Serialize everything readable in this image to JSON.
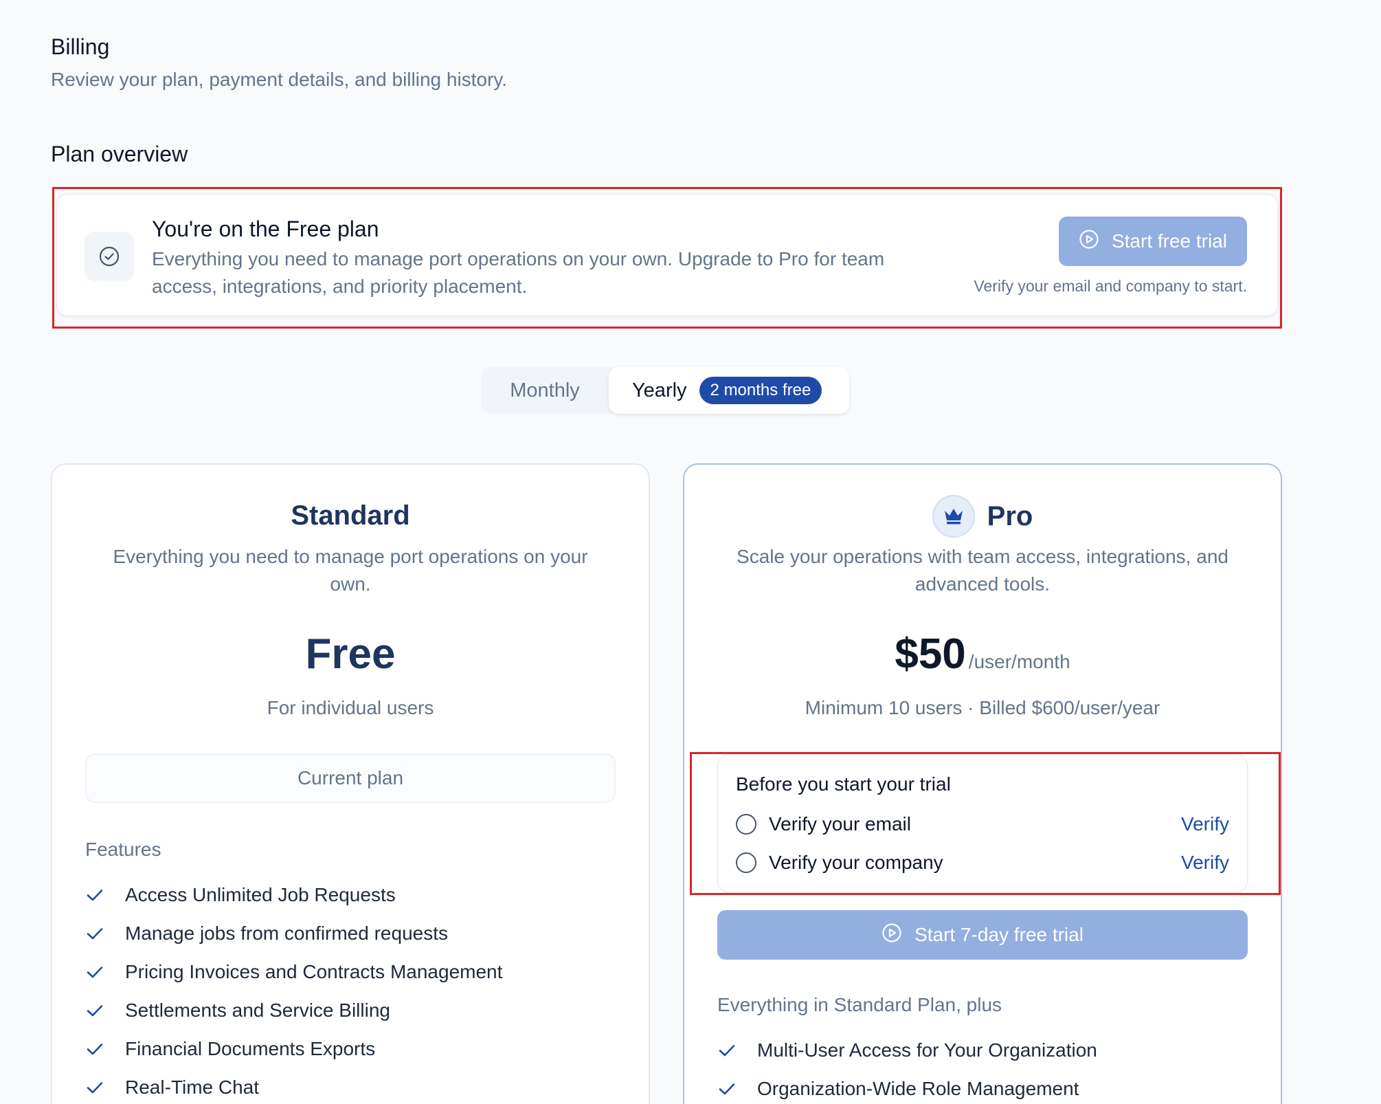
{
  "header": {
    "title": "Billing",
    "subtitle": "Review your plan, payment details, and billing history."
  },
  "plan_overview": {
    "section_title": "Plan overview",
    "banner": {
      "icon": "check-circle-icon",
      "title": "You're on the Free plan",
      "description": "Everything you need to manage port operations on your own. Upgrade to Pro for team access, integrations, and priority placement.",
      "button_icon": "play-circle-icon",
      "button_label": "Start free trial",
      "note": "Verify your email and company to start."
    }
  },
  "billing_toggle": {
    "options": [
      {
        "label": "Monthly",
        "selected": false
      },
      {
        "label": "Yearly",
        "selected": true,
        "badge": "2 months free"
      }
    ]
  },
  "plans": {
    "standard": {
      "name": "Standard",
      "description": "Everything you need to manage port operations on your own.",
      "price": "Free",
      "price_subtext": "For individual users",
      "button_label": "Current plan",
      "features_title": "Features",
      "features": [
        "Access Unlimited Job Requests",
        "Manage jobs from confirmed requests",
        "Pricing Invoices and Contracts Management",
        "Settlements and Service Billing",
        "Financial Documents Exports",
        "Real-Time Chat"
      ]
    },
    "pro": {
      "icon": "crown-icon",
      "name": "Pro",
      "description": "Scale your operations with team access, integrations, and advanced tools.",
      "price_amount": "$50",
      "price_unit": "/user/month",
      "price_subtext": "Minimum 10 users · Billed $600/user/year",
      "trial_checklist": {
        "title": "Before you start your trial",
        "steps": [
          {
            "label": "Verify your email",
            "action": "Verify",
            "completed": false
          },
          {
            "label": "Verify your company",
            "action": "Verify",
            "completed": false
          }
        ]
      },
      "button_icon": "play-circle-icon",
      "button_label": "Start 7-day free trial",
      "features_title": "Everything in Standard Plan, plus",
      "features": [
        "Multi-User Access for Your Organization",
        "Organization-Wide Role Management"
      ]
    }
  },
  "colors": {
    "primary": "#1e4ba8",
    "button_disabled": "#93aee0",
    "highlight": "#dc2626",
    "heading": "#1e3560"
  }
}
